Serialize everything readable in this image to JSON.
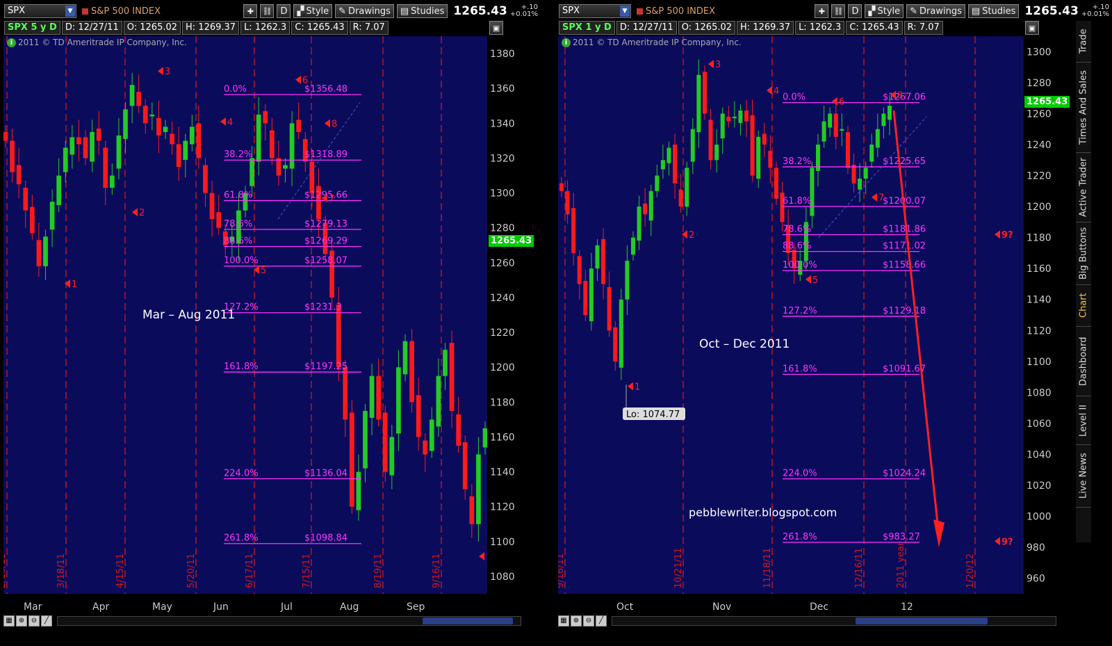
{
  "left_panel": {
    "symbol": "SPX",
    "index_name": "S&P 500 INDEX",
    "toolbar": {
      "d_label": "D",
      "style_label": "Style",
      "drawings_label": "Drawings",
      "studies_label": "Studies"
    },
    "last_price": "1265.43",
    "change_top": "+.10",
    "change_bottom": "+0.01%",
    "status": {
      "period": "SPX 5 y D",
      "date": "D: 12/27/11",
      "open": "O: 1265.02",
      "high": "H: 1269.37",
      "low": "L: 1262.3",
      "close": "C: 1265.43",
      "range": "R: 7.07"
    },
    "copyright": "2011 © TD Ameritrade IP Company, Inc.",
    "price_tag": "1265.43"
  },
  "right_panel": {
    "symbol": "SPX",
    "index_name": "S&P 500 INDEX",
    "toolbar": {
      "d_label": "D",
      "style_label": "Style",
      "drawings_label": "Drawings",
      "studies_label": "Studies"
    },
    "last_price": "1265.43",
    "change_top": "+.10",
    "change_bottom": "+0.01%",
    "status": {
      "period": "SPX 1 y D",
      "date": "D: 12/27/11",
      "open": "O: 1265.02",
      "high": "H: 1269.37",
      "low": "L: 1262.3",
      "close": "C: 1265.43",
      "range": "R: 7.07"
    },
    "copyright": "2011 © TD Ameritrade IP Company, Inc.",
    "price_tag": "1265.43",
    "lo_label": "Lo: 1074.77"
  },
  "side_tabs": [
    "Trade",
    "Times And Sales",
    "Active Trader",
    "Big Buttons",
    "Chart",
    "Dashboard",
    "Level II",
    "Live News"
  ],
  "active_tab": "Chart",
  "colors": {
    "background": "#0b0b5c",
    "up": "#22cc22",
    "down": "#ff1a1a",
    "fib": "#ff33ff",
    "marker": "#ff2020",
    "text_white": "#ffffff"
  },
  "chart_data": [
    {
      "type": "candlestick",
      "title": "Mar – Aug 2011",
      "ylim": [
        1070,
        1390
      ],
      "yticks": [
        1080,
        1100,
        1120,
        1140,
        1160,
        1180,
        1200,
        1220,
        1240,
        1260,
        1280,
        1300,
        1320,
        1340,
        1360,
        1380
      ],
      "months": [
        "Mar",
        "Apr",
        "May",
        "Jun",
        "Jul",
        "Aug",
        "Sep"
      ],
      "date_lines": [
        "2/18/11",
        "3/18/11",
        "4/15/11",
        "5/20/11",
        "6/17/11",
        "7/15/11",
        "8/19/11",
        "9/16/11"
      ],
      "fib_levels": [
        {
          "pct": "0.0%",
          "price": "$1356.48",
          "value": 1356.48
        },
        {
          "pct": "38.2%",
          "price": "$1318.89",
          "value": 1318.89
        },
        {
          "pct": "61.8%",
          "price": "$1295.66",
          "value": 1295.66
        },
        {
          "pct": "78.6%",
          "price": "$1279.13",
          "value": 1279.13
        },
        {
          "pct": "88.6%",
          "price": "$1269.29",
          "value": 1269.29
        },
        {
          "pct": "100.0%",
          "price": "$1258.07",
          "value": 1258.07
        },
        {
          "pct": "127.2%",
          "price": "$1231.3",
          "value": 1231.3
        },
        {
          "pct": "161.8%",
          "price": "$1197.25",
          "value": 1197.25
        },
        {
          "pct": "224.0%",
          "price": "$1136.04",
          "value": 1136.04
        },
        {
          "pct": "261.8%",
          "price": "$1098.84",
          "value": 1098.84
        }
      ],
      "markers": [
        {
          "label": "1",
          "price": 1248
        },
        {
          "label": "2",
          "price": 1289
        },
        {
          "label": "3",
          "price": 1370
        },
        {
          "label": "4",
          "price": 1341
        },
        {
          "label": "5",
          "price": 1256
        },
        {
          "label": "6",
          "price": 1365
        },
        {
          "label": "7",
          "price": 1297
        },
        {
          "label": "8",
          "price": 1340
        }
      ],
      "closes": [
        1330,
        1312,
        1305,
        1290,
        1277,
        1258,
        1275,
        1295,
        1310,
        1326,
        1332,
        1328,
        1320,
        1335,
        1330,
        1303,
        1310,
        1333,
        1348,
        1362,
        1350,
        1340,
        1345,
        1333,
        1338,
        1328,
        1315,
        1330,
        1338,
        1320,
        1300,
        1285,
        1280,
        1270,
        1275,
        1290,
        1300,
        1320,
        1345,
        1340,
        1320,
        1310,
        1316,
        1340,
        1335,
        1318,
        1300,
        1285,
        1265,
        1240,
        1200,
        1170,
        1120,
        1140,
        1175,
        1195,
        1170,
        1140,
        1160,
        1200,
        1215,
        1180,
        1160,
        1150,
        1170,
        1195,
        1210,
        1175,
        1155,
        1130,
        1110,
        1150,
        1165
      ]
    },
    {
      "type": "candlestick",
      "title": "Oct – Dec 2011",
      "ylim": [
        950,
        1310
      ],
      "yticks": [
        960,
        980,
        1000,
        1020,
        1040,
        1060,
        1080,
        1100,
        1120,
        1140,
        1160,
        1180,
        1200,
        1220,
        1240,
        1260,
        1280,
        1300
      ],
      "months": [
        "Oct",
        "Nov",
        "Dec",
        "12"
      ],
      "date_lines": [
        "9/16/11",
        "10/21/11",
        "11/18/11",
        "12/16/11",
        "2011 year",
        "1/20/12"
      ],
      "fib_levels": [
        {
          "pct": "0.0%",
          "price": "$1267.06",
          "value": 1267.06
        },
        {
          "pct": "38.2%",
          "price": "$1225.65",
          "value": 1225.65
        },
        {
          "pct": "61.8%",
          "price": "$1200.07",
          "value": 1200.07
        },
        {
          "pct": "78.6%",
          "price": "$1181.86",
          "value": 1181.86
        },
        {
          "pct": "88.6%",
          "price": "$1171.02",
          "value": 1171.02
        },
        {
          "pct": "100.0%",
          "price": "$1158.66",
          "value": 1158.66
        },
        {
          "pct": "127.2%",
          "price": "$1129.18",
          "value": 1129.18
        },
        {
          "pct": "161.8%",
          "price": "$1091.67",
          "value": 1091.67
        },
        {
          "pct": "224.0%",
          "price": "$1024.24",
          "value": 1024.24
        },
        {
          "pct": "261.8%",
          "price": "$983.27",
          "value": 983.27
        }
      ],
      "markers": [
        {
          "label": "1",
          "price": 1084
        },
        {
          "label": "2",
          "price": 1182
        },
        {
          "label": "3",
          "price": 1292
        },
        {
          "label": "4",
          "price": 1275
        },
        {
          "label": "5",
          "price": 1153
        },
        {
          "label": "6",
          "price": 1268
        },
        {
          "label": "7",
          "price": 1206
        },
        {
          "label": "8",
          "price": 1272
        },
        {
          "label": "9?",
          "price": 1182
        },
        {
          "label": "9?",
          "price": 984
        }
      ],
      "closes": [
        1210,
        1195,
        1170,
        1150,
        1130,
        1160,
        1175,
        1150,
        1120,
        1100,
        1140,
        1165,
        1180,
        1200,
        1195,
        1210,
        1220,
        1230,
        1238,
        1215,
        1200,
        1225,
        1250,
        1285,
        1260,
        1230,
        1240,
        1260,
        1255,
        1258,
        1262,
        1255,
        1220,
        1245,
        1240,
        1225,
        1205,
        1190,
        1170,
        1160,
        1165,
        1190,
        1225,
        1240,
        1255,
        1260,
        1245,
        1250,
        1225,
        1215,
        1218,
        1225,
        1240,
        1250,
        1260,
        1265
      ],
      "annotation": "pebblewriter.blogspot.com"
    }
  ]
}
